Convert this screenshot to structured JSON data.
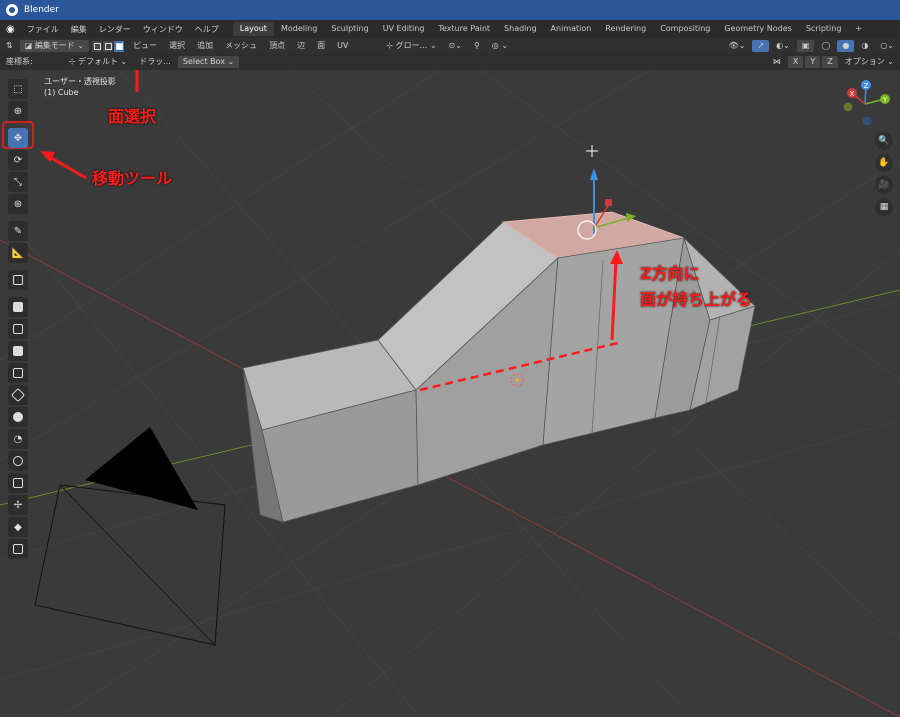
{
  "app": {
    "title": "Blender"
  },
  "menubar": {
    "menus": [
      "ファイル",
      "編集",
      "レンダー",
      "ウィンドウ",
      "ヘルプ"
    ],
    "workspace_tabs": [
      "Layout",
      "Modeling",
      "Sculpting",
      "UV Editing",
      "Texture Paint",
      "Shading",
      "Animation",
      "Rendering",
      "Compositing",
      "Geometry Nodes",
      "Scripting"
    ],
    "active_tab": "Layout",
    "add_tab": "+"
  },
  "header": {
    "mode": "編集モード",
    "select_modes": [
      "vertex",
      "edge",
      "face"
    ],
    "active_select_mode": "face",
    "menus": [
      "ビュー",
      "選択",
      "追加",
      "メッシュ",
      "頂点",
      "辺",
      "面",
      "UV"
    ],
    "transform_orientation": "グロー...",
    "right_icons": [
      "overlay-icon",
      "gizmo-icon",
      "xray-icon",
      "shading-wire",
      "shading-solid",
      "shading-material",
      "shading-render"
    ]
  },
  "subheader": {
    "orientation_label": "座標系:",
    "orientation_value": "デフォルト",
    "drag_label": "ドラッ...",
    "select_box": "Select Box",
    "axes": [
      "X",
      "Y",
      "Z"
    ],
    "options": "オプション"
  },
  "viewport": {
    "view_name": "ユーザー・透視投影",
    "object_name": "(1) Cube",
    "colors": {
      "bg": "#3a3a3a",
      "grid": "#444444",
      "axis_x": "#8b3a3a",
      "axis_y": "#6b8a2a",
      "mesh": "#9a9a9a",
      "selected_face": "#d2a9a2"
    }
  },
  "annotations": {
    "face_select": "面選択",
    "move_tool": "移動ツール",
    "z_line1": "Z方向に",
    "z_line2": "面が持ち上がる",
    "color": "#ff1a1a"
  },
  "toolbar": {
    "tools": [
      "select-box-icon",
      "cursor-icon",
      "move-icon",
      "rotate-icon",
      "scale-icon",
      "transform-icon",
      "annotate-icon",
      "measure-icon",
      "add-cube-icon",
      "extrude-icon",
      "inset-icon",
      "bevel-icon",
      "loopcut-icon",
      "knife-icon",
      "polybuild-icon",
      "spin-icon",
      "smooth-icon",
      "edge-slide-icon",
      "shrink-icon",
      "shear-icon",
      "rip-icon"
    ],
    "active_tool": "move-icon"
  },
  "navigation_gizmo": {
    "axes": [
      "X",
      "Y",
      "Z"
    ]
  },
  "right_nav": [
    "zoom-icon",
    "pan-icon",
    "camera-view-icon",
    "ortho-grid-icon"
  ]
}
